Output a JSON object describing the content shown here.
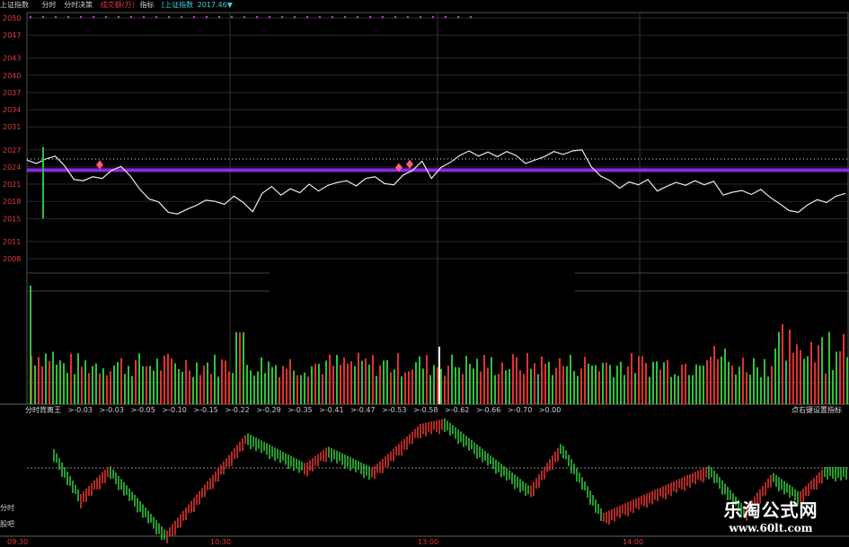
{
  "header": {
    "index_name": "上证指数",
    "intraday": "分时",
    "strategy": "分时决策",
    "volume_label": "成交额(万)",
    "indicator": "指标",
    "bracket_label": "[上证指数",
    "bracket_value": "2017.46▼"
  },
  "price_axis": {
    "labels": [
      "2050",
      "2047",
      "2043",
      "2040",
      "2037",
      "2034",
      "2031",
      "2027",
      "2024",
      "2021",
      "2018",
      "2015",
      "2011",
      "2008"
    ],
    "values": [
      2050,
      2047,
      2043,
      2040,
      2037,
      2034,
      2031,
      2027,
      2024,
      2021,
      2018,
      2015,
      2011,
      2008
    ]
  },
  "time_axis": [
    "09:30",
    "10:30",
    "13:00",
    "14:00"
  ],
  "indicator_panel": {
    "name": "分时背离王",
    "values": [
      ">-0.03",
      ">-0.03",
      ">-0.05",
      ">-0.10",
      ">-0.15",
      ">-0.22",
      ">-0.29",
      ">-0.35",
      ">-0.41",
      ">-0.47",
      ">-0.53",
      ">-0.58",
      ">-0.62",
      ">-0.66",
      ">-0.70",
      ">0.00"
    ],
    "hint": "点右键设置指标"
  },
  "side_labels": [
    "分时",
    "股吧"
  ],
  "watermark": {
    "title": "乐淘公式网",
    "url": "www.60lt.com"
  },
  "colors": {
    "up": "#e0322f",
    "down": "#2fc23a",
    "price_line": "#e8e8e8",
    "avg_band": "#8a2be2",
    "axis_text": "#e23b3b",
    "header_text": "#ccc",
    "accent_cyan": "#3ccfe0"
  },
  "chart_data": {
    "type": "line",
    "x": [
      "09:30",
      "10:30",
      "13:00",
      "14:00"
    ],
    "ylim": [
      2008,
      2050
    ],
    "series": [
      {
        "values": [
          2025.2,
          2024.6,
          2025.4,
          2025.9,
          2024.2,
          2021.8,
          2021.6,
          2022.3,
          2022.0,
          2023.4,
          2024.1,
          2022.4,
          2020.1,
          2018.4,
          2017.9,
          2016.1,
          2015.8,
          2016.6,
          2017.3,
          2018.2,
          2018.0,
          2017.5,
          2018.9,
          2017.8,
          2016.2,
          2019.4,
          2020.6,
          2019.1,
          2020.2,
          2019.5,
          2021.0,
          2019.8,
          2020.8,
          2021.3,
          2021.6,
          2020.7,
          2022.0,
          2022.3,
          2021.1,
          2020.9,
          2022.6,
          2023.4,
          2025.0,
          2022.0,
          2023.9,
          2024.8,
          2026.0,
          2026.8,
          2025.9,
          2026.6,
          2025.8,
          2026.7,
          2026.0,
          2024.6,
          2025.2,
          2025.8,
          2026.7,
          2026.2,
          2026.8,
          2027.0,
          2024.0,
          2022.4,
          2021.6,
          2020.3,
          2021.4,
          2020.9,
          2021.8,
          2019.8,
          2020.6,
          2021.3,
          2020.8,
          2021.6,
          2020.9,
          2021.5,
          2019.1,
          2019.6,
          2019.9,
          2019.2,
          2020.1,
          2018.7,
          2017.6,
          2016.4,
          2016.1,
          2017.4,
          2018.3,
          2017.8,
          2018.9,
          2019.4
        ]
      }
    ]
  }
}
